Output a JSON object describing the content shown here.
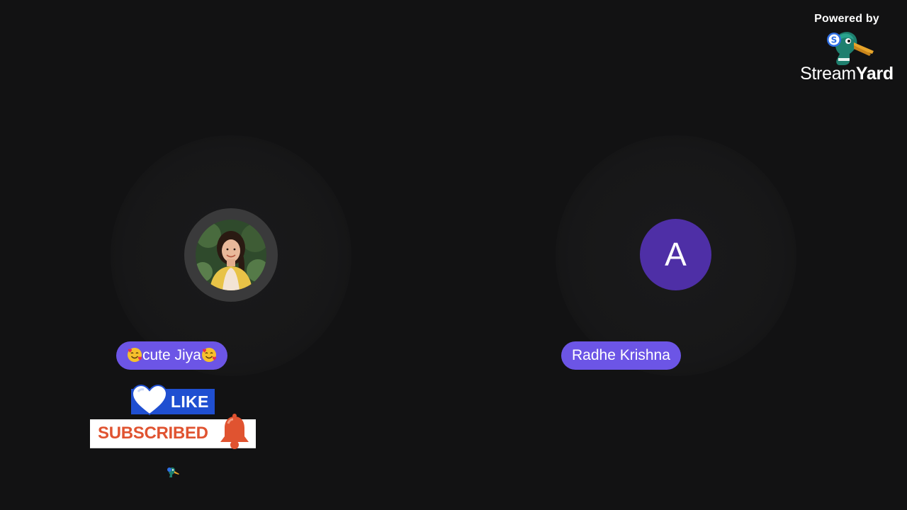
{
  "branding": {
    "powered_by": "Powered by",
    "wordmark_regular": "Stream",
    "wordmark_bold": "Yard",
    "logo_icon": "streamyard-duck-icon"
  },
  "participants": [
    {
      "name": "cute Jiya",
      "name_prefix_emoji": "smiling-face-with-hearts-icon",
      "name_suffix_emoji": "smiling-face-with-hearts-icon",
      "avatar_type": "photo"
    },
    {
      "name": "Radhe Krishna",
      "avatar_type": "initial",
      "avatar_initial": "A",
      "avatar_color": "#4e2fa6"
    }
  ],
  "overlays": {
    "like_label": "LIKE",
    "subscribed_label": "SUBSCRIBED"
  },
  "colors": {
    "background": "#121213",
    "name_pill": "#6c55e6",
    "like_badge": "#1f4fd1",
    "subscribed_text": "#e05330"
  }
}
